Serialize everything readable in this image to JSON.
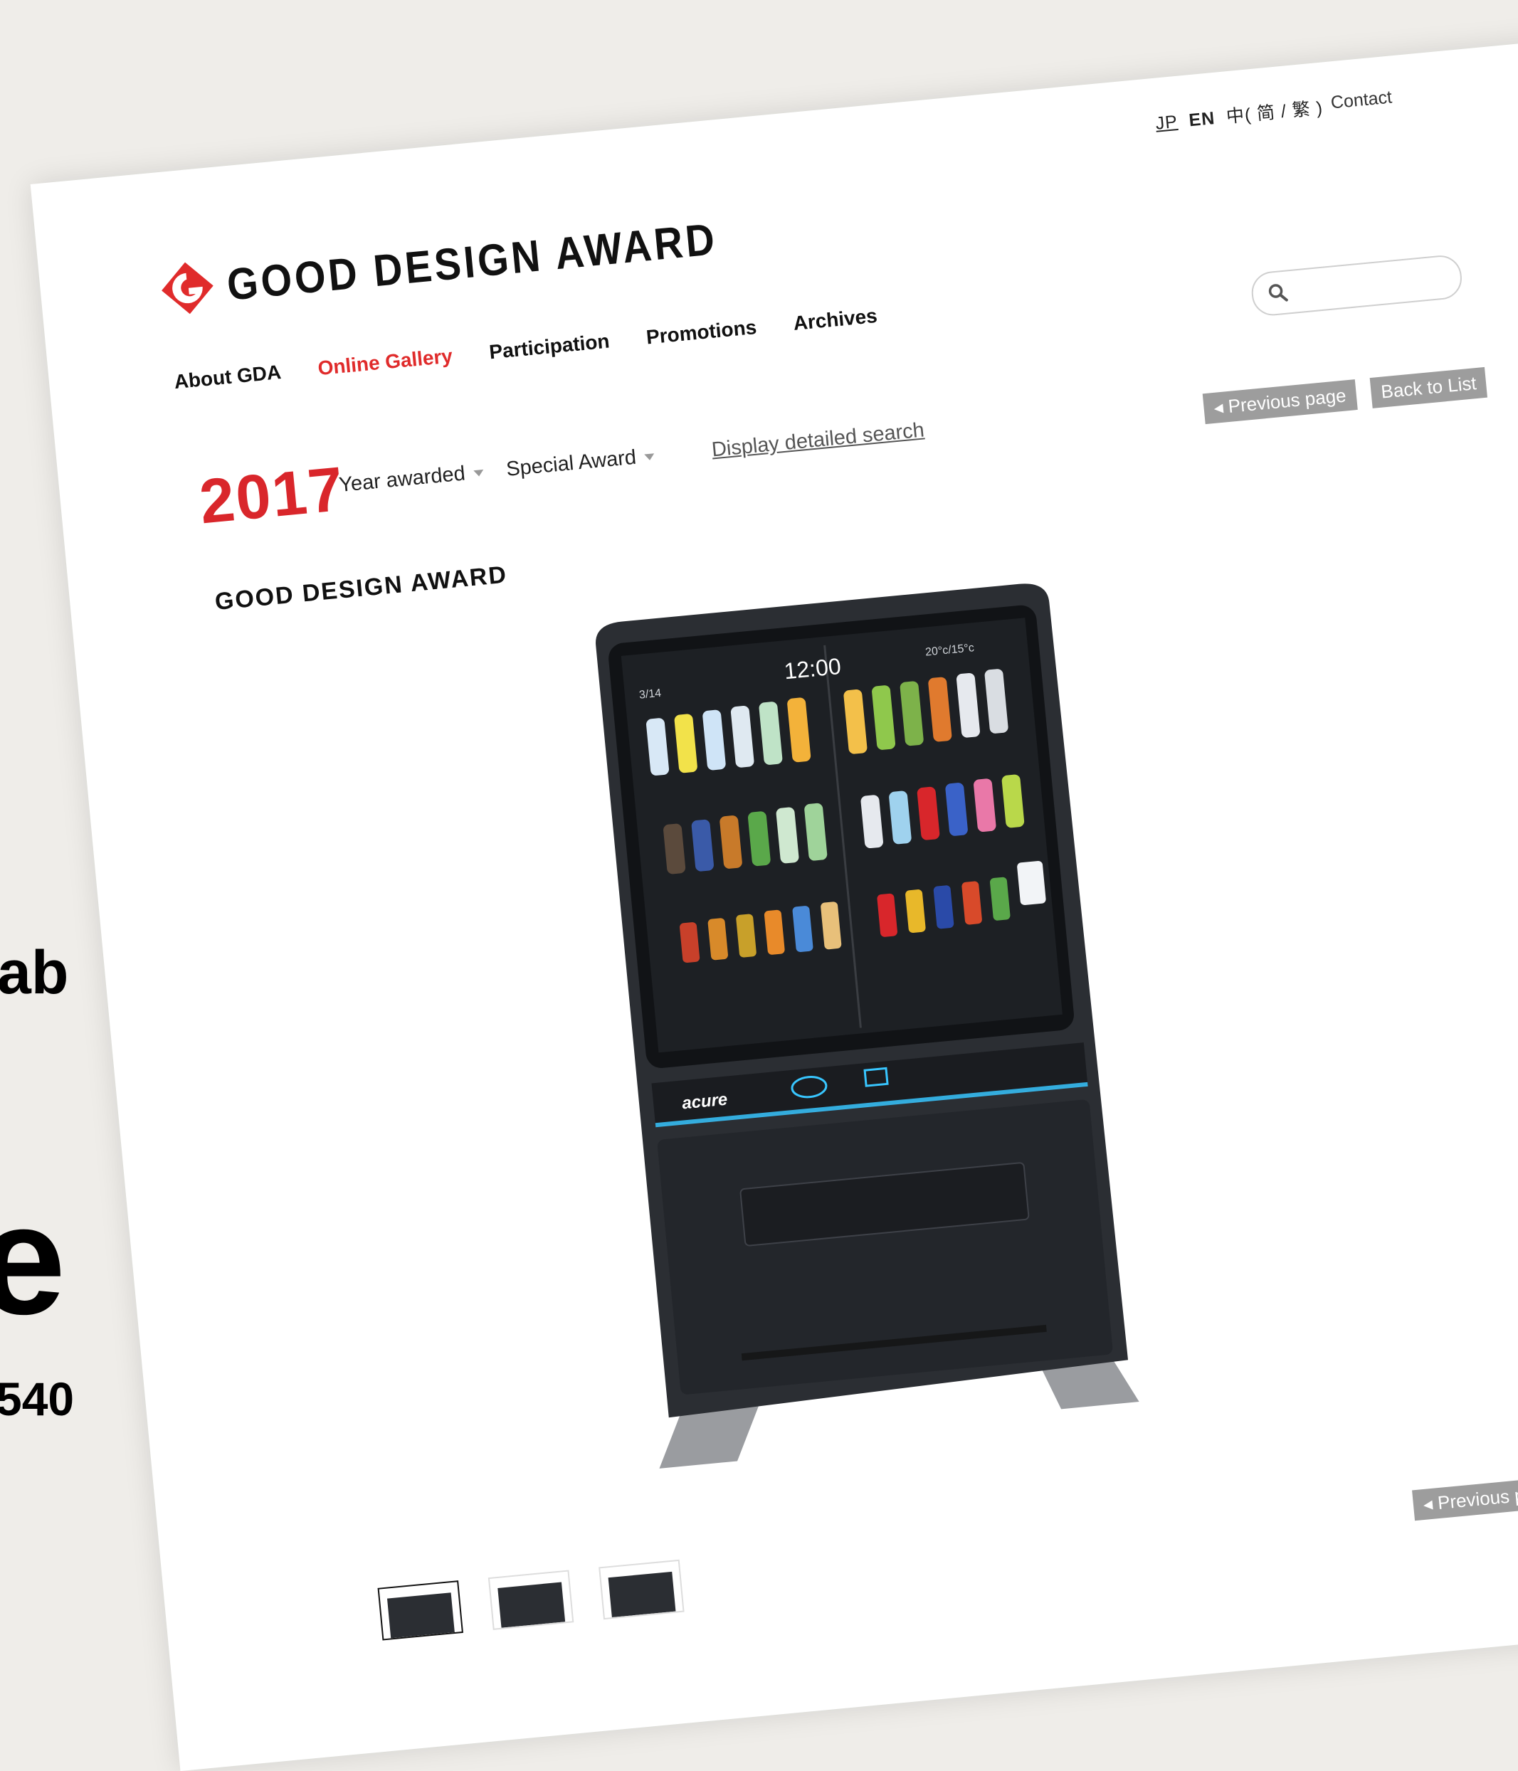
{
  "background_text": {
    "fragment_1": "ab",
    "fragment_2": "e",
    "fragment_3": "540"
  },
  "header": {
    "languages": {
      "jp": "JP",
      "en": "EN",
      "zh": "中( 简 / 繁 )"
    },
    "contact": "Contact",
    "logo_text": "GOOD DESIGN AWARD",
    "nav": [
      "About GDA",
      "Online Gallery",
      "Participation",
      "Promotions",
      "Archives"
    ],
    "active_nav": "Online Gallery"
  },
  "search": {
    "placeholder": ""
  },
  "filter": {
    "year": "2017",
    "year_awarded": "Year awarded",
    "special_award": "Special Award",
    "detail_search": "Display detailed search"
  },
  "pager": {
    "previous": "Previous page",
    "back": "Back to List"
  },
  "award_label": "GOOD DESIGN AWARD",
  "product": {
    "screen_time": "12:00",
    "screen_date": "3/14",
    "screen_temp": "20°c/15°c",
    "brand": "acure"
  },
  "colors": {
    "accent_red": "#d9262b",
    "button_gray": "#9d9d9d",
    "machine_body": "#2b2e33"
  }
}
